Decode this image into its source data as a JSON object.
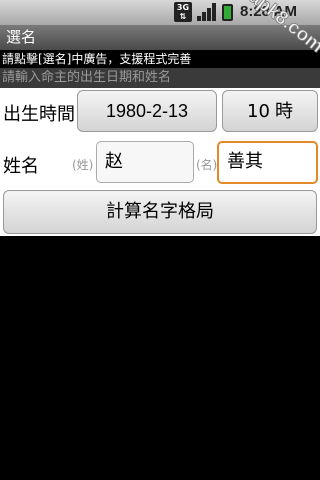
{
  "statusbar": {
    "network_label": "3G",
    "time": "8:28 AM"
  },
  "titlebar": {
    "title": "選名"
  },
  "ad_notice": "請點擊[選名]中廣告，支援程式完善",
  "hint": "請輸入命主的出生日期和姓名",
  "birth": {
    "label": "出生時間",
    "date": "1980-2-13",
    "hour": "10",
    "hour_unit": "時"
  },
  "name": {
    "label": "姓名",
    "surname_tag": "(姓)",
    "surname_value": "赵",
    "given_tag": "(名)",
    "given_value": "善其"
  },
  "calc_button": "計算名字格局",
  "watermark": "apk8.com",
  "colors": {
    "focus_border": "#e08a2a",
    "title_bg": "#5a5a5a"
  }
}
